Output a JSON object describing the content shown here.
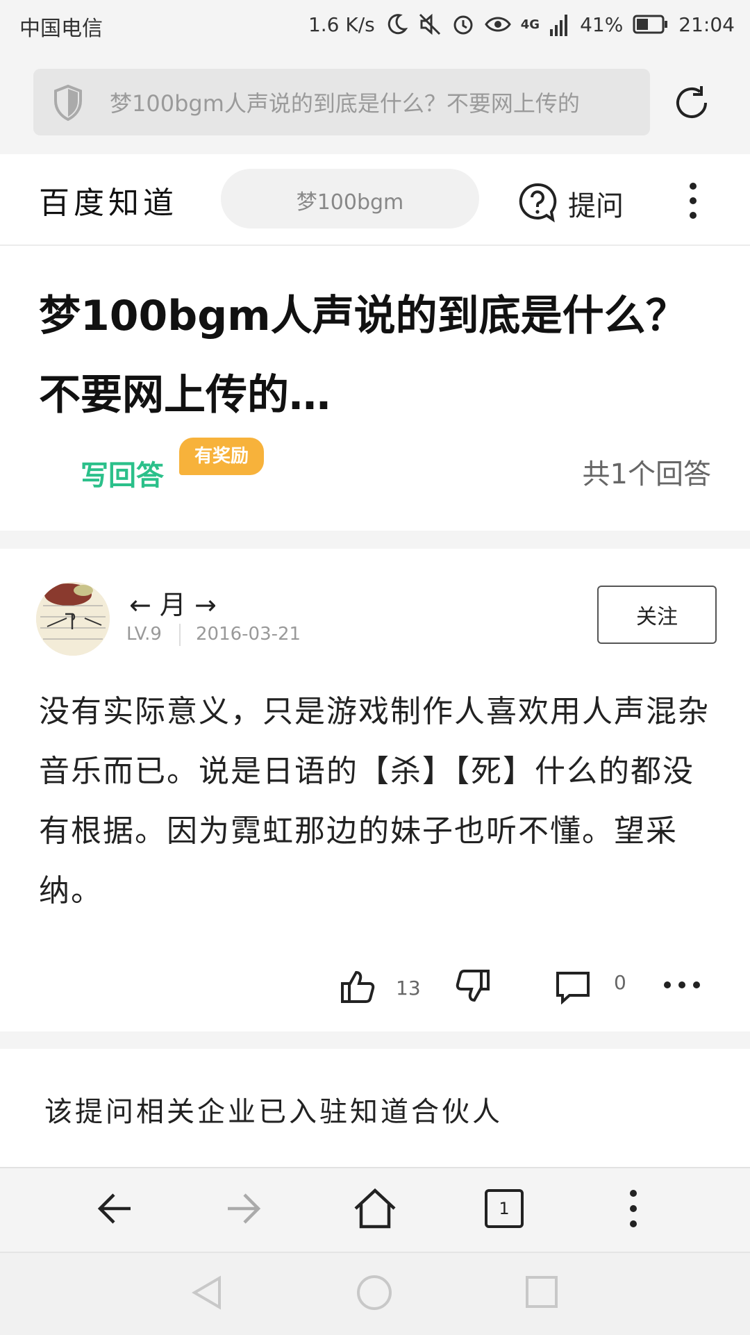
{
  "status_bar": {
    "carrier": "中国电信",
    "speed": "1.6 K/s",
    "network": "4G",
    "battery": "41%",
    "time": "21:04"
  },
  "url_bar": {
    "text": "梦100bgm人声说的到底是什么？不要网上传的"
  },
  "header": {
    "brand": "百度知道",
    "search_chip": "梦100bgm",
    "ask_label": "提问"
  },
  "question": {
    "title": "梦100bgm人声说的到底是什么？不要网上传的…",
    "write_answer_label": "写回答",
    "reward_badge": "有奖励",
    "answer_count": "共1个回答"
  },
  "answer": {
    "username": "← 月 →",
    "level": "LV.9",
    "date": "2016-03-21",
    "follow_label": "关注",
    "text": "没有实际意义，只是游戏制作人喜欢用人声混杂音乐而已。说是日语的【杀】【死】什么的都没有根据。因为霓虹那边的妹子也听不懂。望采纳。",
    "like_count": "13",
    "comment_count": "0"
  },
  "related": {
    "text": "该提问相关企业已入驻知道合伙人"
  },
  "toolbar": {
    "tab_count": "1"
  },
  "colors": {
    "accent_green": "#2bc08a",
    "reward_orange": "#f7b23b"
  }
}
